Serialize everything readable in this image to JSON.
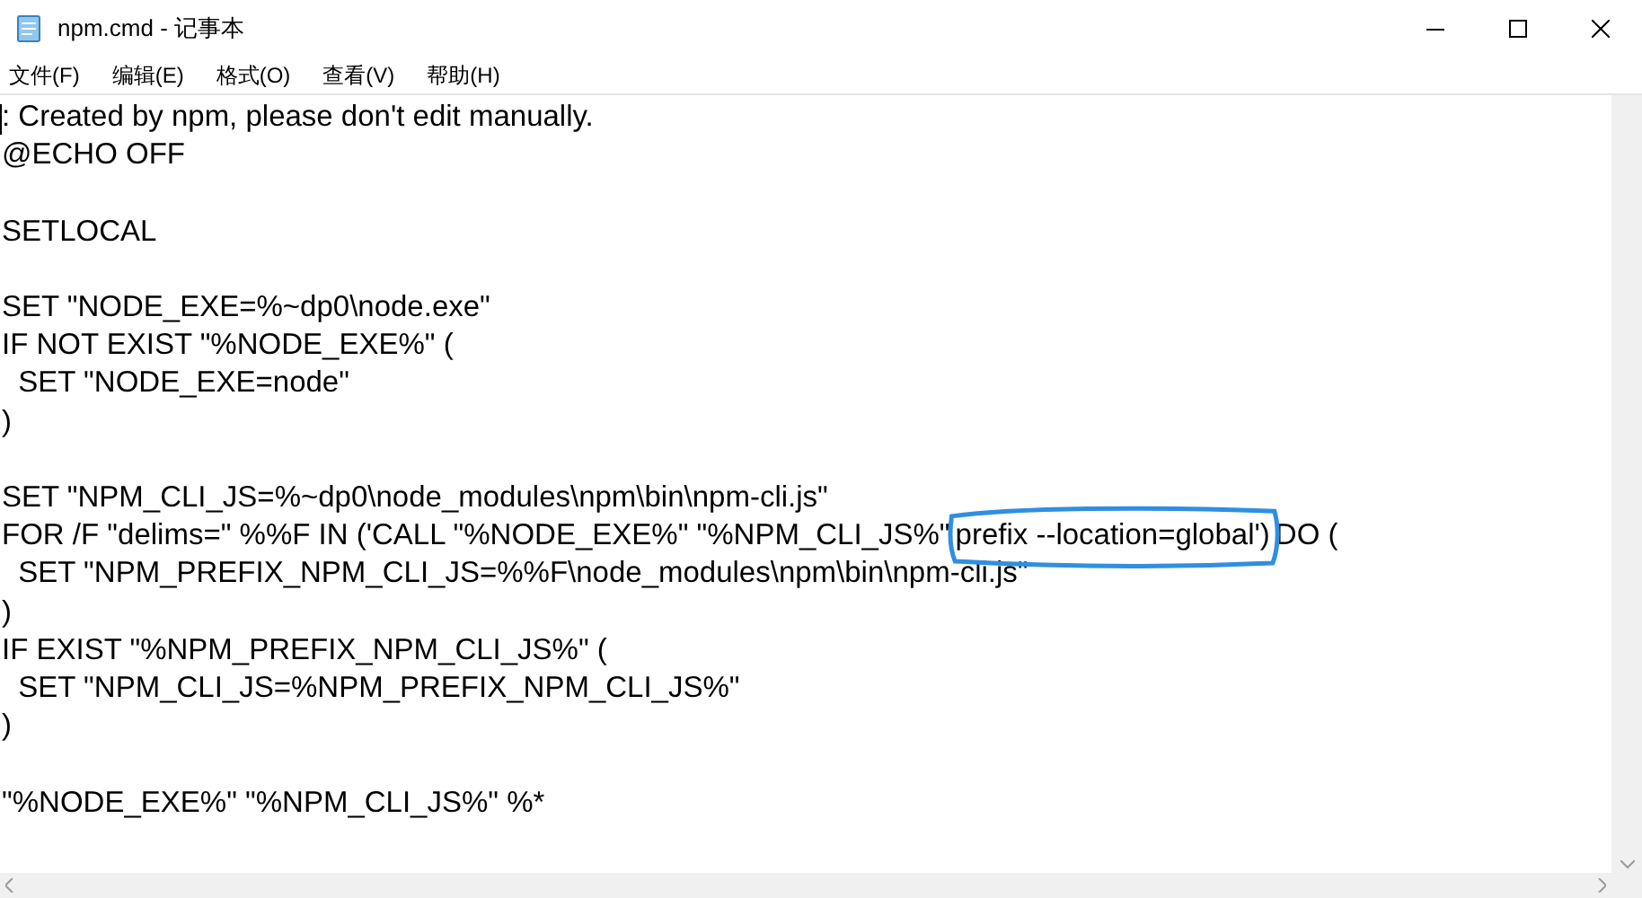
{
  "window": {
    "title": "npm.cmd - 记事本"
  },
  "menu": [
    "文件(F)",
    "编辑(E)",
    "格式(O)",
    "查看(V)",
    "帮助(H)"
  ],
  "editor": {
    "lines": [
      {
        "kind": "code",
        "segments": [
          {
            "text": ": Created by npm, please don't edit manually.",
            "circled": false
          }
        ]
      },
      {
        "kind": "code",
        "segments": [
          {
            "text": "@ECHO OFF",
            "circled": false
          }
        ]
      },
      {
        "kind": "blank"
      },
      {
        "kind": "code",
        "segments": [
          {
            "text": "SETLOCAL",
            "circled": false
          }
        ]
      },
      {
        "kind": "blank"
      },
      {
        "kind": "code",
        "segments": [
          {
            "text": "SET \"NODE_EXE=%~dp0\\node.exe\"",
            "circled": false
          }
        ]
      },
      {
        "kind": "code",
        "segments": [
          {
            "text": "IF NOT EXIST \"%NODE_EXE%\" (",
            "circled": false
          }
        ]
      },
      {
        "kind": "code",
        "segments": [
          {
            "text": "  SET \"NODE_EXE=node\"",
            "circled": false
          }
        ]
      },
      {
        "kind": "code",
        "segments": [
          {
            "text": ")",
            "circled": false
          }
        ]
      },
      {
        "kind": "blank"
      },
      {
        "kind": "code",
        "segments": [
          {
            "text": "SET \"NPM_CLI_JS=%~dp0\\node_modules\\npm\\bin\\npm-cli.js\"",
            "circled": false
          }
        ]
      },
      {
        "kind": "code",
        "segments": [
          {
            "text": "FOR /F \"delims=\" %%F IN ('CALL \"%NODE_EXE%\" \"%NPM_CLI_JS%\"",
            "circled": false
          },
          {
            "text": "prefix --location=global')",
            "circled": true
          },
          {
            "text": "DO (",
            "circled": false
          }
        ]
      },
      {
        "kind": "code",
        "segments": [
          {
            "text": "  SET \"NPM_PREFIX_NPM_CLI_JS=%%F\\node_modules\\npm\\bin\\npm-cli.js\"",
            "circled": false
          }
        ]
      },
      {
        "kind": "code",
        "segments": [
          {
            "text": ")",
            "circled": false
          }
        ]
      },
      {
        "kind": "code",
        "segments": [
          {
            "text": "IF EXIST \"%NPM_PREFIX_NPM_CLI_JS%\" (",
            "circled": false
          }
        ]
      },
      {
        "kind": "code",
        "segments": [
          {
            "text": "  SET \"NPM_CLI_JS=%NPM_PREFIX_NPM_CLI_JS%\"",
            "circled": false
          }
        ]
      },
      {
        "kind": "code",
        "segments": [
          {
            "text": ")",
            "circled": false
          }
        ]
      },
      {
        "kind": "blank"
      },
      {
        "kind": "code",
        "segments": [
          {
            "text": "\"%NODE_EXE%\" \"%NPM_CLI_JS%\" %*",
            "circled": false
          }
        ]
      }
    ]
  }
}
